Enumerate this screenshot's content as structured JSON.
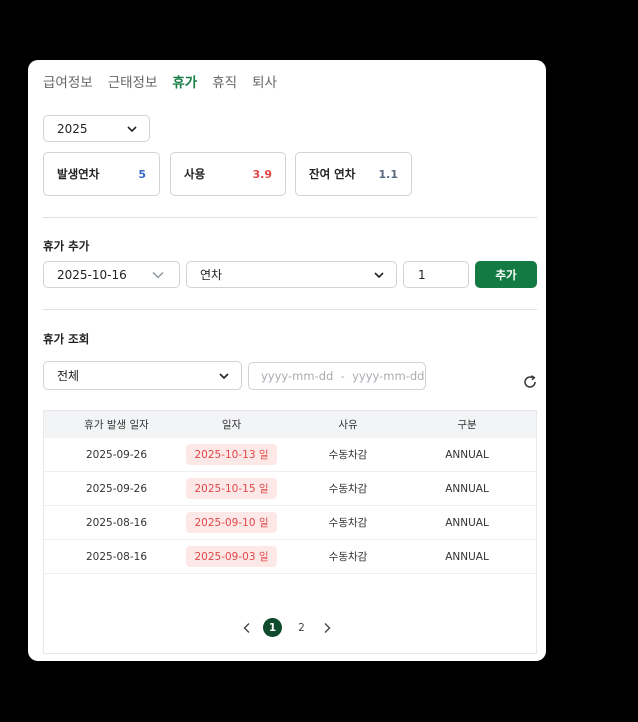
{
  "tabs": [
    {
      "label": "급여정보"
    },
    {
      "label": "근태정보"
    },
    {
      "label": "휴가"
    },
    {
      "label": "휴직"
    },
    {
      "label": "퇴사"
    }
  ],
  "active_tab": "휴가",
  "year_select": {
    "value": "2025"
  },
  "stats": {
    "generated": {
      "label": "발생연차",
      "value": "5",
      "color": "#3a68c9"
    },
    "used": {
      "label": "사용",
      "value": "3.9",
      "color": "#e04848"
    },
    "remaining": {
      "label": "잔여 연차",
      "value": "1.1",
      "color": "#5a6a7e"
    }
  },
  "add_section": {
    "title": "휴가 추가",
    "date_value": "2025-10-16",
    "type_value": "연차",
    "amount_value": "1",
    "add_button": "추가"
  },
  "lookup_section": {
    "title": "휴가 조회",
    "filter_value": "전체",
    "date_range_placeholder": "yyyy-mm-dd  -  yyyy-mm-dd"
  },
  "table": {
    "headers": [
      "휴가 발생 일자",
      "일자",
      "사유",
      "구분"
    ],
    "rows": [
      {
        "generated_date": "2025-09-26",
        "date": "2025-10-13 일",
        "reason": "수동차감",
        "type": "ANNUAL"
      },
      {
        "generated_date": "2025-09-26",
        "date": "2025-10-15 일",
        "reason": "수동차감",
        "type": "ANNUAL"
      },
      {
        "generated_date": "2025-08-16",
        "date": "2025-09-10 일",
        "reason": "수동차감",
        "type": "ANNUAL"
      },
      {
        "generated_date": "2025-08-16",
        "date": "2025-09-03 일",
        "reason": "수동차감",
        "type": "ANNUAL"
      }
    ]
  },
  "pagination": {
    "pages": [
      "1",
      "2"
    ],
    "current": "1"
  },
  "colors": {
    "accent": "#137a43",
    "pill_bg": "#fde8e8",
    "pill_text": "#e04848"
  }
}
